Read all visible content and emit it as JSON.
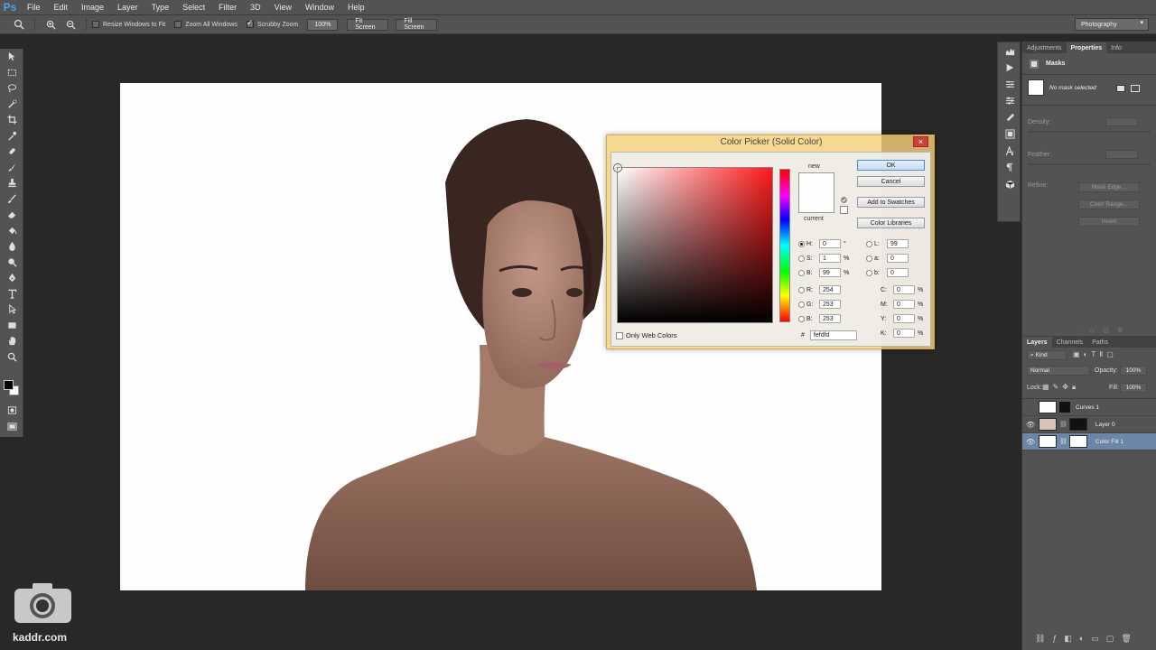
{
  "app": {
    "logo": "Ps"
  },
  "menu": [
    "File",
    "Edit",
    "Image",
    "Layer",
    "Type",
    "Select",
    "Filter",
    "3D",
    "View",
    "Window",
    "Help"
  ],
  "options": {
    "resize_windows": "Resize Windows to Fit",
    "zoom_all": "Zoom All Windows",
    "scrubby_zoom": "Scrubby Zoom",
    "zoom_value": "100%",
    "fit_screen": "Fit Screen",
    "fill_screen": "Fill Screen",
    "workspace": "Photography"
  },
  "properties_panel": {
    "tabs": [
      "Adjustments",
      "Properties",
      "Info"
    ],
    "section": "Masks",
    "mask_status": "No mask selected",
    "density": "Density:",
    "feather": "Feather:",
    "refine": "Refine:",
    "mask_edge": "Mask Edge...",
    "color_range": "Color Range...",
    "invert": "Invert"
  },
  "layers_panel": {
    "tabs": [
      "Layers",
      "Channels",
      "Paths"
    ],
    "kind": "Kind",
    "blend_mode": "Normal",
    "opacity_label": "Opacity:",
    "opacity": "100%",
    "lock_label": "Lock:",
    "fill_label": "Fill:",
    "fill": "100%",
    "layers": [
      {
        "name": "Curves 1",
        "visible": false
      },
      {
        "name": "Layer 0",
        "visible": true
      },
      {
        "name": "Color Fill 1",
        "visible": true,
        "selected": true
      }
    ]
  },
  "color_picker": {
    "title": "Color Picker (Solid Color)",
    "close": "×",
    "new_label": "new",
    "current_label": "current",
    "buttons": {
      "ok": "OK",
      "cancel": "Cancel",
      "add_swatches": "Add to Swatches",
      "libraries": "Color Libraries"
    },
    "fields": {
      "H": "0",
      "S": "1",
      "B": "99",
      "R": "254",
      "G": "253",
      "Bb": "253",
      "L": "99",
      "a": "0",
      "b": "0",
      "C": "0",
      "M": "0",
      "Y": "0",
      "K": "0"
    },
    "units": {
      "deg": "°",
      "pct": "%"
    },
    "hex_label": "#",
    "hex": "fefdfd",
    "only_web": "Only Web Colors",
    "new_color": "#fefdfd",
    "current_color": "#fefdfd"
  },
  "watermark": "kaddr.com"
}
